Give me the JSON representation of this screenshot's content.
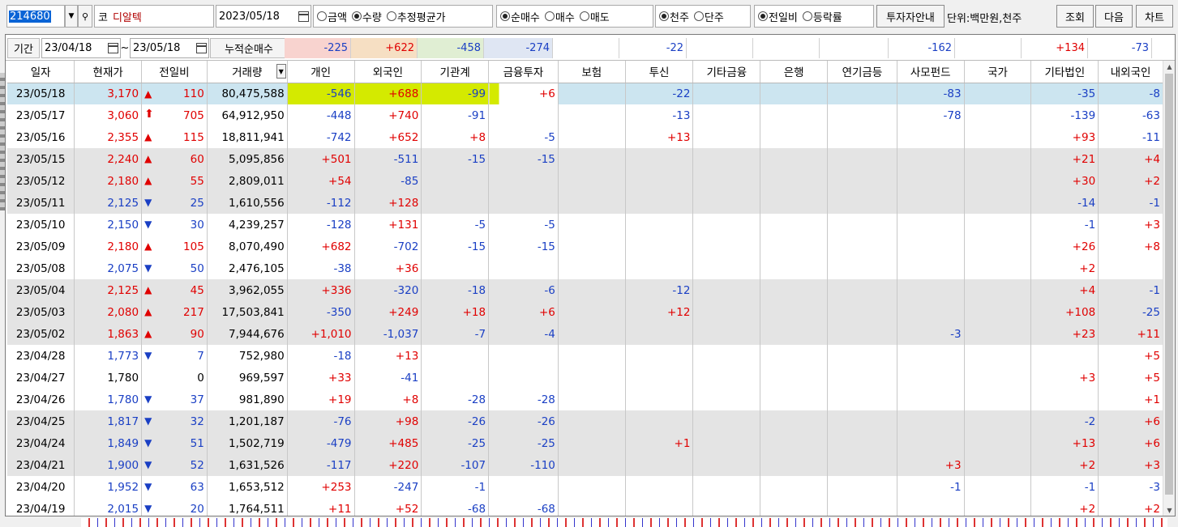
{
  "toolbar": {
    "code": "214680",
    "name_prefix": "코",
    "name": "디알텍",
    "date": "2023/05/18",
    "amount_group": [
      {
        "label": "금액",
        "selected": false
      },
      {
        "label": "수량",
        "selected": true
      },
      {
        "label": "추정평균가",
        "selected": false
      }
    ],
    "trade_group": [
      {
        "label": "순매수",
        "selected": true
      },
      {
        "label": "매수",
        "selected": false
      },
      {
        "label": "매도",
        "selected": false
      }
    ],
    "share_group": [
      {
        "label": "천주",
        "selected": true
      },
      {
        "label": "단주",
        "selected": false
      }
    ],
    "change_group": [
      {
        "label": "전일비",
        "selected": true
      },
      {
        "label": "등락률",
        "selected": false
      }
    ],
    "investor_guide_button": "투자자안내",
    "unit_text": "단위:백만원,천주",
    "query_button": "조회",
    "next_button": "다음",
    "chart_button": "차트"
  },
  "period": {
    "label": "기간",
    "from": "23/04/18",
    "tilde": "~",
    "to": "23/05/18",
    "cumulative_label": "누적순매수"
  },
  "cumulative": [
    "-225",
    "+622",
    "-458",
    "-274",
    "",
    "-22",
    "",
    "",
    "",
    "-162",
    "",
    "+134",
    "-73"
  ],
  "columns": [
    "일자",
    "현재가",
    "전일비",
    "거래량",
    "개인",
    "외국인",
    "기관계",
    "금융투자",
    "보험",
    "투신",
    "기타금융",
    "은행",
    "연기금등",
    "사모펀드",
    "국가",
    "기타법인",
    "내외국인"
  ],
  "rows": [
    {
      "date": "23/05/18",
      "price": "3,170",
      "dir": "up",
      "change": "110",
      "volume": "80,475,588",
      "cells": [
        "-546",
        "+688",
        "-99",
        "+6",
        "",
        "-22",
        "",
        "",
        "",
        "-83",
        "",
        "-35",
        "-8"
      ]
    },
    {
      "date": "23/05/17",
      "price": "3,060",
      "dir": "limit",
      "change": "705",
      "volume": "64,912,950",
      "cells": [
        "-448",
        "+740",
        "-91",
        "",
        "",
        "-13",
        "",
        "",
        "",
        "-78",
        "",
        "-139",
        "-63"
      ]
    },
    {
      "date": "23/05/16",
      "price": "2,355",
      "dir": "up",
      "change": "115",
      "volume": "18,811,941",
      "cells": [
        "-742",
        "+652",
        "+8",
        "-5",
        "",
        "+13",
        "",
        "",
        "",
        "",
        "",
        "+93",
        "-11"
      ]
    },
    {
      "date": "23/05/15",
      "price": "2,240",
      "dir": "up",
      "change": "60",
      "volume": "5,095,856",
      "cells": [
        "+501",
        "-511",
        "-15",
        "-15",
        "",
        "",
        "",
        "",
        "",
        "",
        "",
        "+21",
        "+4"
      ]
    },
    {
      "date": "23/05/12",
      "price": "2,180",
      "dir": "up",
      "change": "55",
      "volume": "2,809,011",
      "cells": [
        "+54",
        "-85",
        "",
        "",
        "",
        "",
        "",
        "",
        "",
        "",
        "",
        "+30",
        "+2"
      ]
    },
    {
      "date": "23/05/11",
      "price": "2,125",
      "dir": "down",
      "change": "25",
      "volume": "1,610,556",
      "cells": [
        "-112",
        "+128",
        "",
        "",
        "",
        "",
        "",
        "",
        "",
        "",
        "",
        "-14",
        "-1"
      ]
    },
    {
      "date": "23/05/10",
      "price": "2,150",
      "dir": "down",
      "change": "30",
      "volume": "4,239,257",
      "cells": [
        "-128",
        "+131",
        "-5",
        "-5",
        "",
        "",
        "",
        "",
        "",
        "",
        "",
        "-1",
        "+3"
      ]
    },
    {
      "date": "23/05/09",
      "price": "2,180",
      "dir": "up",
      "change": "105",
      "volume": "8,070,490",
      "cells": [
        "+682",
        "-702",
        "-15",
        "-15",
        "",
        "",
        "",
        "",
        "",
        "",
        "",
        "+26",
        "+8"
      ]
    },
    {
      "date": "23/05/08",
      "price": "2,075",
      "dir": "down",
      "change": "50",
      "volume": "2,476,105",
      "cells": [
        "-38",
        "+36",
        "",
        "",
        "",
        "",
        "",
        "",
        "",
        "",
        "",
        "+2",
        ""
      ]
    },
    {
      "date": "23/05/04",
      "price": "2,125",
      "dir": "up",
      "change": "45",
      "volume": "3,962,055",
      "cells": [
        "+336",
        "-320",
        "-18",
        "-6",
        "",
        "-12",
        "",
        "",
        "",
        "",
        "",
        "+4",
        "-1"
      ]
    },
    {
      "date": "23/05/03",
      "price": "2,080",
      "dir": "up",
      "change": "217",
      "volume": "17,503,841",
      "cells": [
        "-350",
        "+249",
        "+18",
        "+6",
        "",
        "+12",
        "",
        "",
        "",
        "",
        "",
        "+108",
        "-25"
      ]
    },
    {
      "date": "23/05/02",
      "price": "1,863",
      "dir": "up",
      "change": "90",
      "volume": "7,944,676",
      "cells": [
        "+1,010",
        "-1,037",
        "-7",
        "-4",
        "",
        "",
        "",
        "",
        "",
        "-3",
        "",
        "+23",
        "+11"
      ]
    },
    {
      "date": "23/04/28",
      "price": "1,773",
      "dir": "down",
      "change": "7",
      "volume": "752,980",
      "cells": [
        "-18",
        "+13",
        "",
        "",
        "",
        "",
        "",
        "",
        "",
        "",
        "",
        "",
        "+5"
      ]
    },
    {
      "date": "23/04/27",
      "price": "1,780",
      "dir": "none",
      "change": "0",
      "volume": "969,597",
      "cells": [
        "+33",
        "-41",
        "",
        "",
        "",
        "",
        "",
        "",
        "",
        "",
        "",
        "+3",
        "+5"
      ]
    },
    {
      "date": "23/04/26",
      "price": "1,780",
      "dir": "down",
      "change": "37",
      "volume": "981,890",
      "cells": [
        "+19",
        "+8",
        "-28",
        "-28",
        "",
        "",
        "",
        "",
        "",
        "",
        "",
        "",
        "+1"
      ]
    },
    {
      "date": "23/04/25",
      "price": "1,817",
      "dir": "down",
      "change": "32",
      "volume": "1,201,187",
      "cells": [
        "-76",
        "+98",
        "-26",
        "-26",
        "",
        "",
        "",
        "",
        "",
        "",
        "",
        "-2",
        "+6"
      ]
    },
    {
      "date": "23/04/24",
      "price": "1,849",
      "dir": "down",
      "change": "51",
      "volume": "1,502,719",
      "cells": [
        "-479",
        "+485",
        "-25",
        "-25",
        "",
        "+1",
        "",
        "",
        "",
        "",
        "",
        "+13",
        "+6"
      ]
    },
    {
      "date": "23/04/21",
      "price": "1,900",
      "dir": "down",
      "change": "52",
      "volume": "1,631,526",
      "cells": [
        "-117",
        "+220",
        "-107",
        "-110",
        "",
        "",
        "",
        "",
        "",
        "+3",
        "",
        "+2",
        "+3"
      ]
    },
    {
      "date": "23/04/20",
      "price": "1,952",
      "dir": "down",
      "change": "63",
      "volume": "1,653,512",
      "cells": [
        "+253",
        "-247",
        "-1",
        "",
        "",
        "",
        "",
        "",
        "",
        "-1",
        "",
        "-1",
        "-3"
      ]
    },
    {
      "date": "23/04/19",
      "price": "2,015",
      "dir": "down",
      "change": "20",
      "volume": "1,764,511",
      "cells": [
        "+11",
        "+52",
        "-68",
        "-68",
        "",
        "",
        "",
        "",
        "",
        "",
        "",
        "+2",
        "+2"
      ]
    }
  ],
  "colors": {
    "up": "#e00000",
    "down": "#1a3fc4",
    "highlight": "#d4ea00",
    "selected_row": "#cce5f0",
    "gray_band": "#e4e4e4"
  }
}
